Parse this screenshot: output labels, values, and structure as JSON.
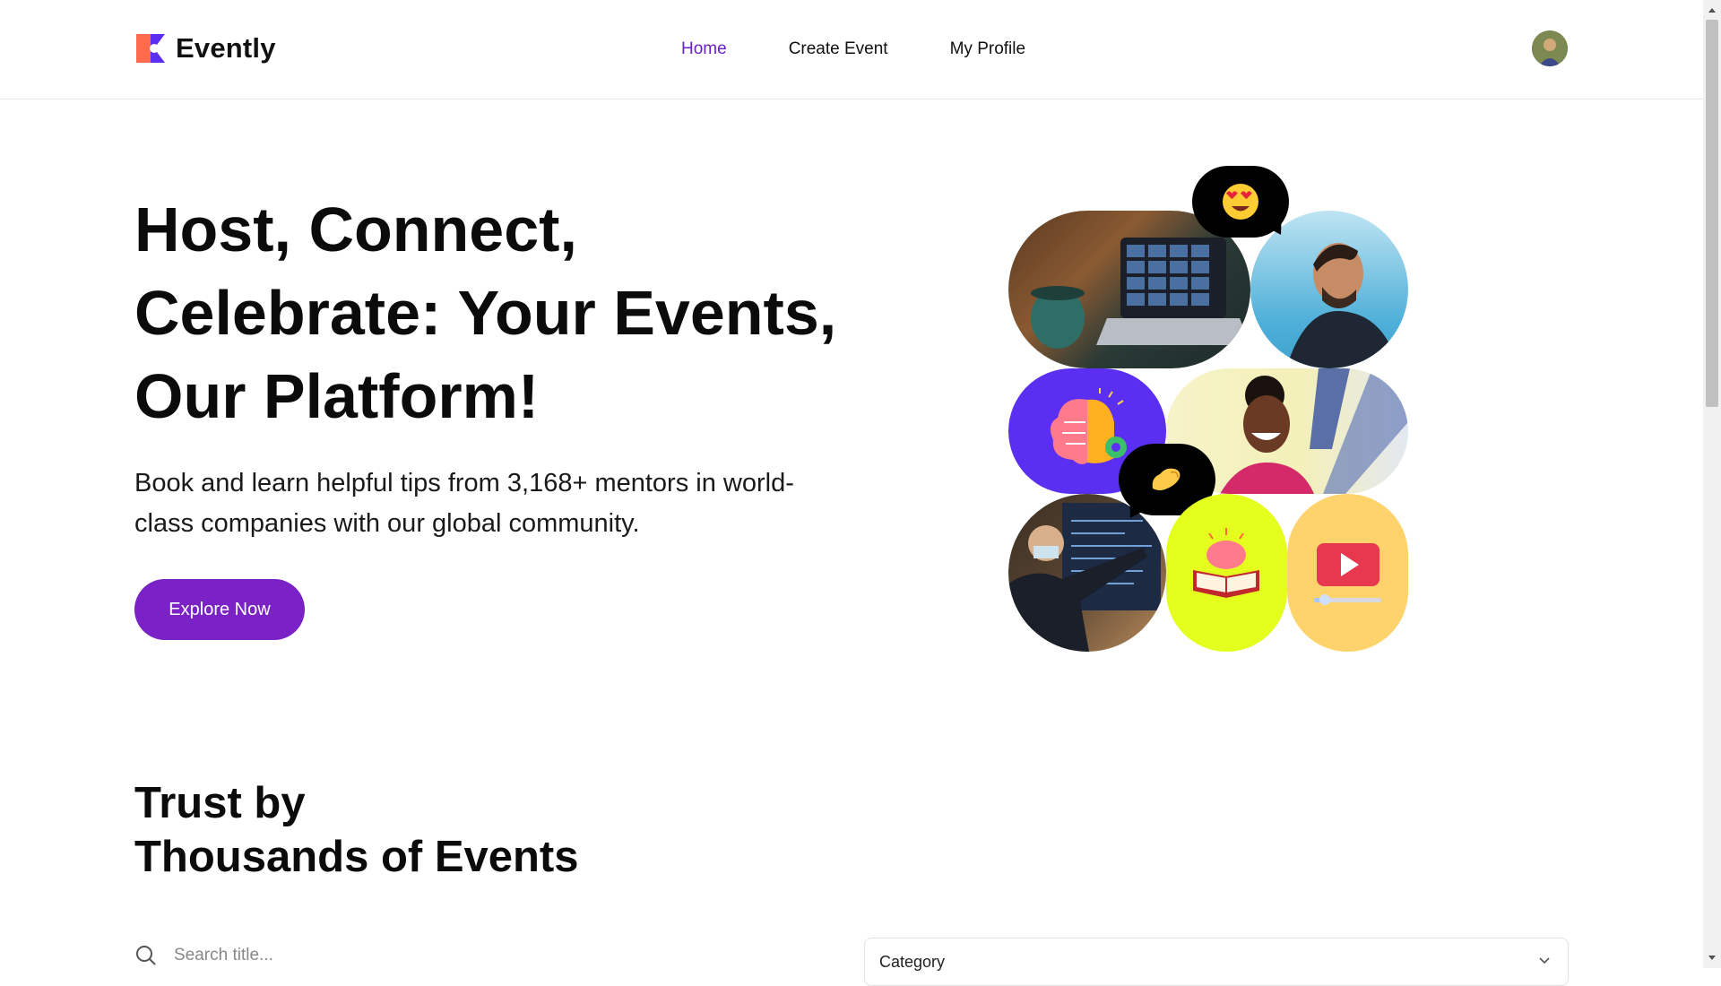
{
  "brand": {
    "name": "Evently"
  },
  "nav": {
    "items": [
      {
        "label": "Home",
        "active": true
      },
      {
        "label": "Create Event",
        "active": false
      },
      {
        "label": "My Profile",
        "active": false
      }
    ]
  },
  "hero": {
    "title_line1": "Host, Connect,",
    "title_line2": "Celebrate: Your Events,",
    "title_line3": "Our Platform!",
    "subtitle": "Book and learn helpful tips from 3,168+ mentors in world-class companies with our global community.",
    "cta_label": "Explore Now"
  },
  "section": {
    "title_line1": "Trust by",
    "title_line2": "Thousands of Events"
  },
  "search": {
    "placeholder": "Search title..."
  },
  "category": {
    "label": "Category"
  },
  "colors": {
    "accent": "#7a22c6",
    "nav_active": "#6b21c8",
    "tile_purple": "#5b2ff2",
    "tile_lime": "#e4ff1e",
    "tile_yellow": "#ffd36b"
  },
  "icons": [
    "search-icon",
    "chevron-down-icon",
    "brain-gear-icon",
    "brain-book-icon",
    "video-play-icon",
    "heart-eyes-emoji",
    "pinch-hand-emoji"
  ]
}
